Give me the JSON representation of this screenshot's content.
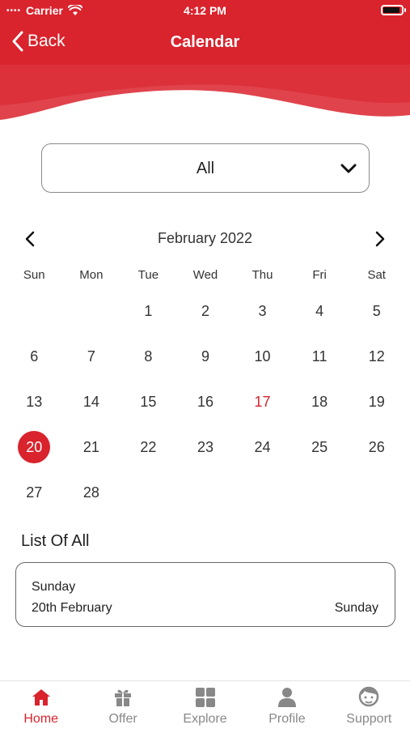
{
  "status_bar": {
    "carrier": "Carrier",
    "time": "4:12 PM"
  },
  "nav": {
    "back_label": "Back",
    "title": "Calendar"
  },
  "filter": {
    "selected": "All"
  },
  "calendar": {
    "month_label": "February 2022",
    "weekdays": [
      "Sun",
      "Mon",
      "Tue",
      "Wed",
      "Thu",
      "Fri",
      "Sat"
    ],
    "leading_blanks": 2,
    "days_in_month": 28,
    "today": 17,
    "selected": 20
  },
  "list": {
    "title": "List Of All",
    "items": [
      {
        "day_name": "Sunday",
        "date": "20th February",
        "right_label": "Sunday"
      }
    ]
  },
  "tabbar": {
    "items": [
      {
        "label": "Home",
        "icon": "home-icon",
        "active": true
      },
      {
        "label": "Offer",
        "icon": "gift-icon",
        "active": false
      },
      {
        "label": "Explore",
        "icon": "grid-icon",
        "active": false
      },
      {
        "label": "Profile",
        "icon": "person-icon",
        "active": false
      },
      {
        "label": "Support",
        "icon": "support-agent-icon",
        "active": false
      }
    ]
  },
  "colors": {
    "brand_red": "#d9232d",
    "inactive_gray": "#888888"
  }
}
